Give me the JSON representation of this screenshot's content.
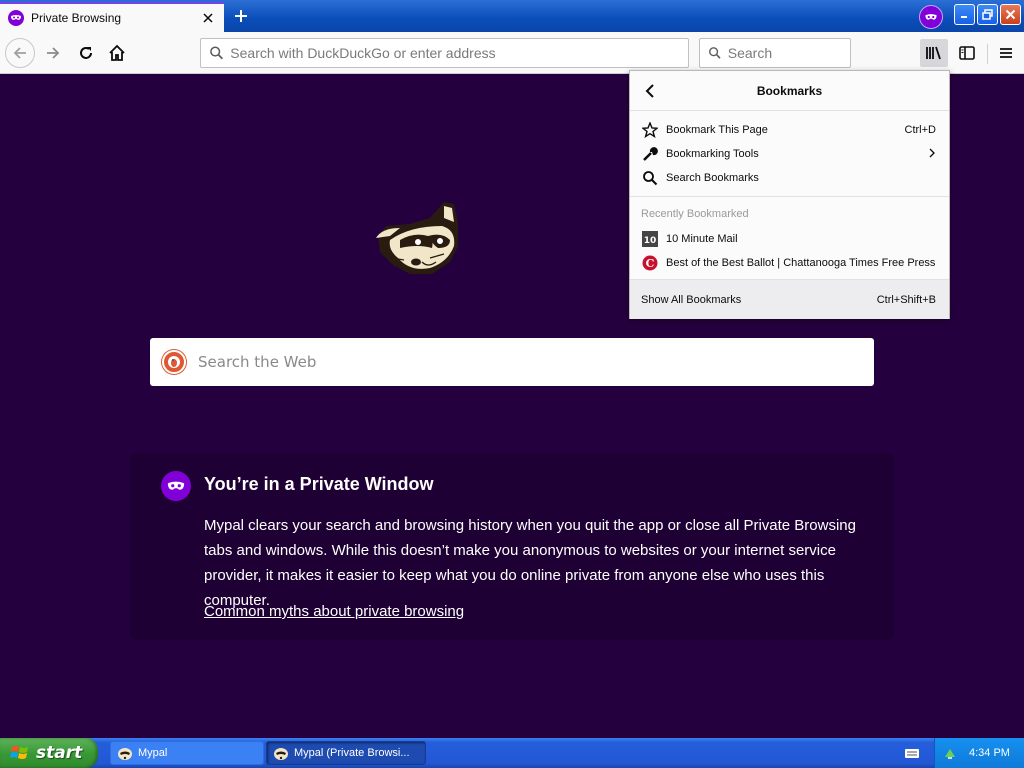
{
  "browser": {
    "tab_title": "Private Browsing",
    "urlbar_placeholder": "Search with DuckDuckGo or enter address",
    "searchbar_placeholder": "Search"
  },
  "page": {
    "web_search_placeholder": "Search the Web",
    "private_title": "You’re in a Private Window",
    "private_description": "Mypal clears your search and browsing history when you quit the app or close all Private Browsing tabs and windows. While this doesn’t make you anonymous to websites or your internet service provider, it makes it easier to keep what you do online private from anyone else who uses this computer.",
    "private_link": "Common myths about private browsing"
  },
  "bookmarks_panel": {
    "title": "Bookmarks",
    "items": [
      {
        "label": "Bookmark This Page",
        "shortcut": "Ctrl+D",
        "icon": "star-icon"
      },
      {
        "label": "Bookmarking Tools",
        "shortcut": "",
        "icon": "wrench-icon"
      },
      {
        "label": "Search Bookmarks",
        "shortcut": "",
        "icon": "search-icon"
      }
    ],
    "recent_label": "Recently Bookmarked",
    "recent": [
      {
        "label": "10 Minute Mail",
        "icon_text": "10"
      },
      {
        "label": "Best of the Best Ballot | Chattanooga Times Free Press",
        "icon_text": "C"
      }
    ],
    "footer_label": "Show All Bookmarks",
    "footer_shortcut": "Ctrl+Shift+B"
  },
  "taskbar": {
    "start_label": "start",
    "tasks": [
      {
        "label": "Mypal"
      },
      {
        "label": "Mypal (Private Browsi..."
      }
    ],
    "clock": "4:34 PM"
  },
  "colors": {
    "page_background": "#25003e",
    "private_purple": "#8000d7",
    "taskbar_blue": "#245edb",
    "start_green": "#3a9a37"
  }
}
